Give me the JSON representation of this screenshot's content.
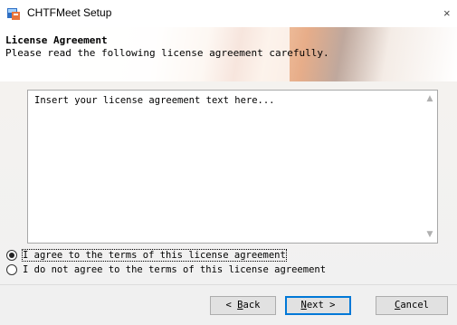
{
  "window": {
    "title": "CHTFMeet Setup",
    "close_glyph": "×"
  },
  "header": {
    "title": "License Agreement",
    "subtitle": "Please read the following license agreement carefully."
  },
  "license": {
    "text": "Insert your license agreement text here..."
  },
  "options": {
    "agree_label": "I agree to the terms of this license agreement",
    "agree_selected": true,
    "disagree_label": "I do not agree to the terms of this license agreement",
    "disagree_selected": false
  },
  "buttons": {
    "back_prefix": "< ",
    "back_accel": "B",
    "back_rest": "ack",
    "next_accel": "N",
    "next_rest": "ext >",
    "cancel_accel": "C",
    "cancel_rest": "ancel"
  },
  "icons": {
    "app": "installer-icon",
    "scroll_up": "chevron-up-icon",
    "scroll_down": "chevron-down-icon"
  },
  "colors": {
    "accent": "#0078d7",
    "button_bg": "#e1e1e1",
    "dialog_bg": "#f0f0f0"
  }
}
